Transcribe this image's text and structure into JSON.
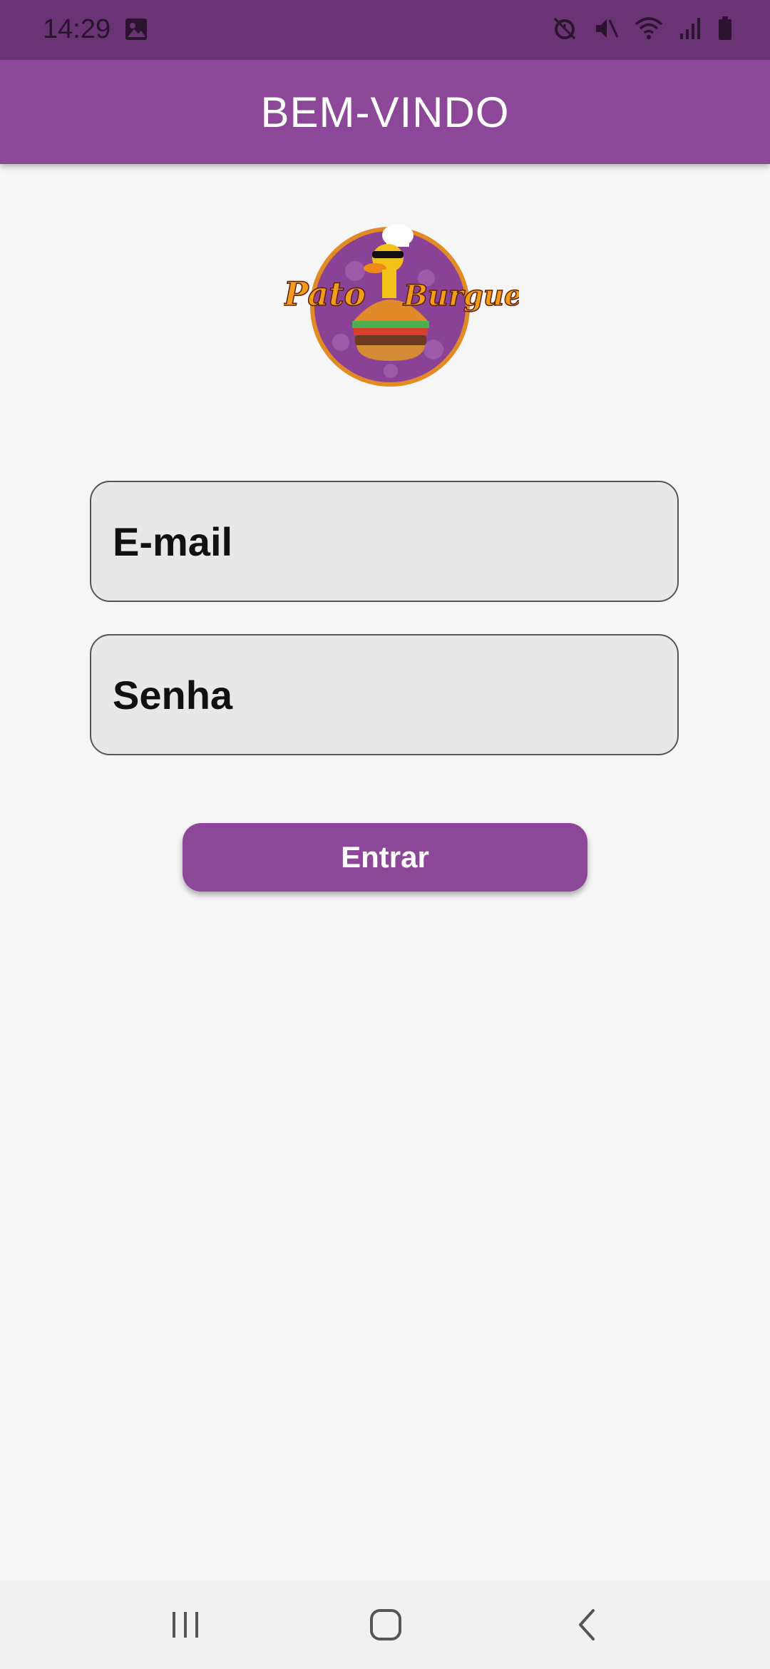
{
  "status_bar": {
    "time": "14:29",
    "icons": [
      "gallery-icon",
      "alarm-icon",
      "mute-icon",
      "wifi-icon",
      "signal-icon",
      "battery-icon"
    ]
  },
  "app_bar": {
    "title": "BEM-VINDO"
  },
  "logo": {
    "text_left": "Pato",
    "text_right": "Burguer"
  },
  "form": {
    "email_placeholder": "E-mail",
    "password_placeholder": "Senha",
    "submit_label": "Entrar"
  },
  "nav_bar": {
    "buttons": [
      "recent-apps-icon",
      "home-icon",
      "back-icon"
    ]
  },
  "colors": {
    "primary": "#8d4798",
    "status_bar": "#6a3373",
    "background": "#f6f6f6",
    "field_bg": "#e8e8e8"
  }
}
